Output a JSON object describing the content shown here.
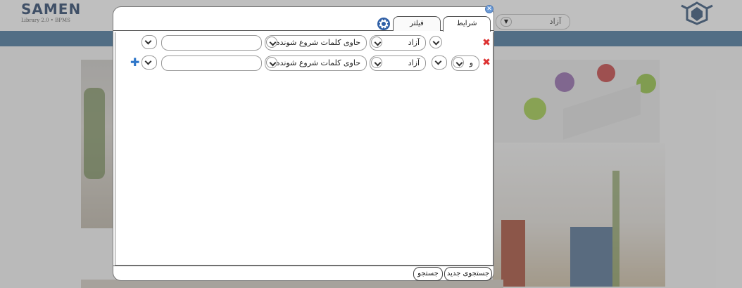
{
  "background": {
    "logo": {
      "title": "SAMEN",
      "subtitle": "Library 2.0 • BPMS"
    },
    "top_select": {
      "value": "آزاد"
    }
  },
  "dialog": {
    "tabs": [
      {
        "label": "شرایط",
        "active": true
      },
      {
        "label": "فیلتر",
        "active": false
      }
    ],
    "rows": [
      {
        "scope_value": "آزاد",
        "operator_value": "حاوی کلمات شروع شونده با",
        "search_value": ""
      },
      {
        "logic_value": "و",
        "scope_value": "آزاد",
        "operator_value": "حاوی کلمات شروع شونده با",
        "search_value": ""
      }
    ],
    "footer": {
      "new_search_label": "جستجوی جدید",
      "search_label": "جستجو"
    }
  },
  "colors": {
    "band": "#3f6f97",
    "delete": "#dd3333",
    "add": "#2e76c9",
    "close": "#6d9bd6"
  },
  "icons": {
    "close": "close-icon",
    "settings": "gear-icon",
    "delete": "delete-icon",
    "add": "add-icon",
    "dropdown": "chevron-down-icon"
  }
}
